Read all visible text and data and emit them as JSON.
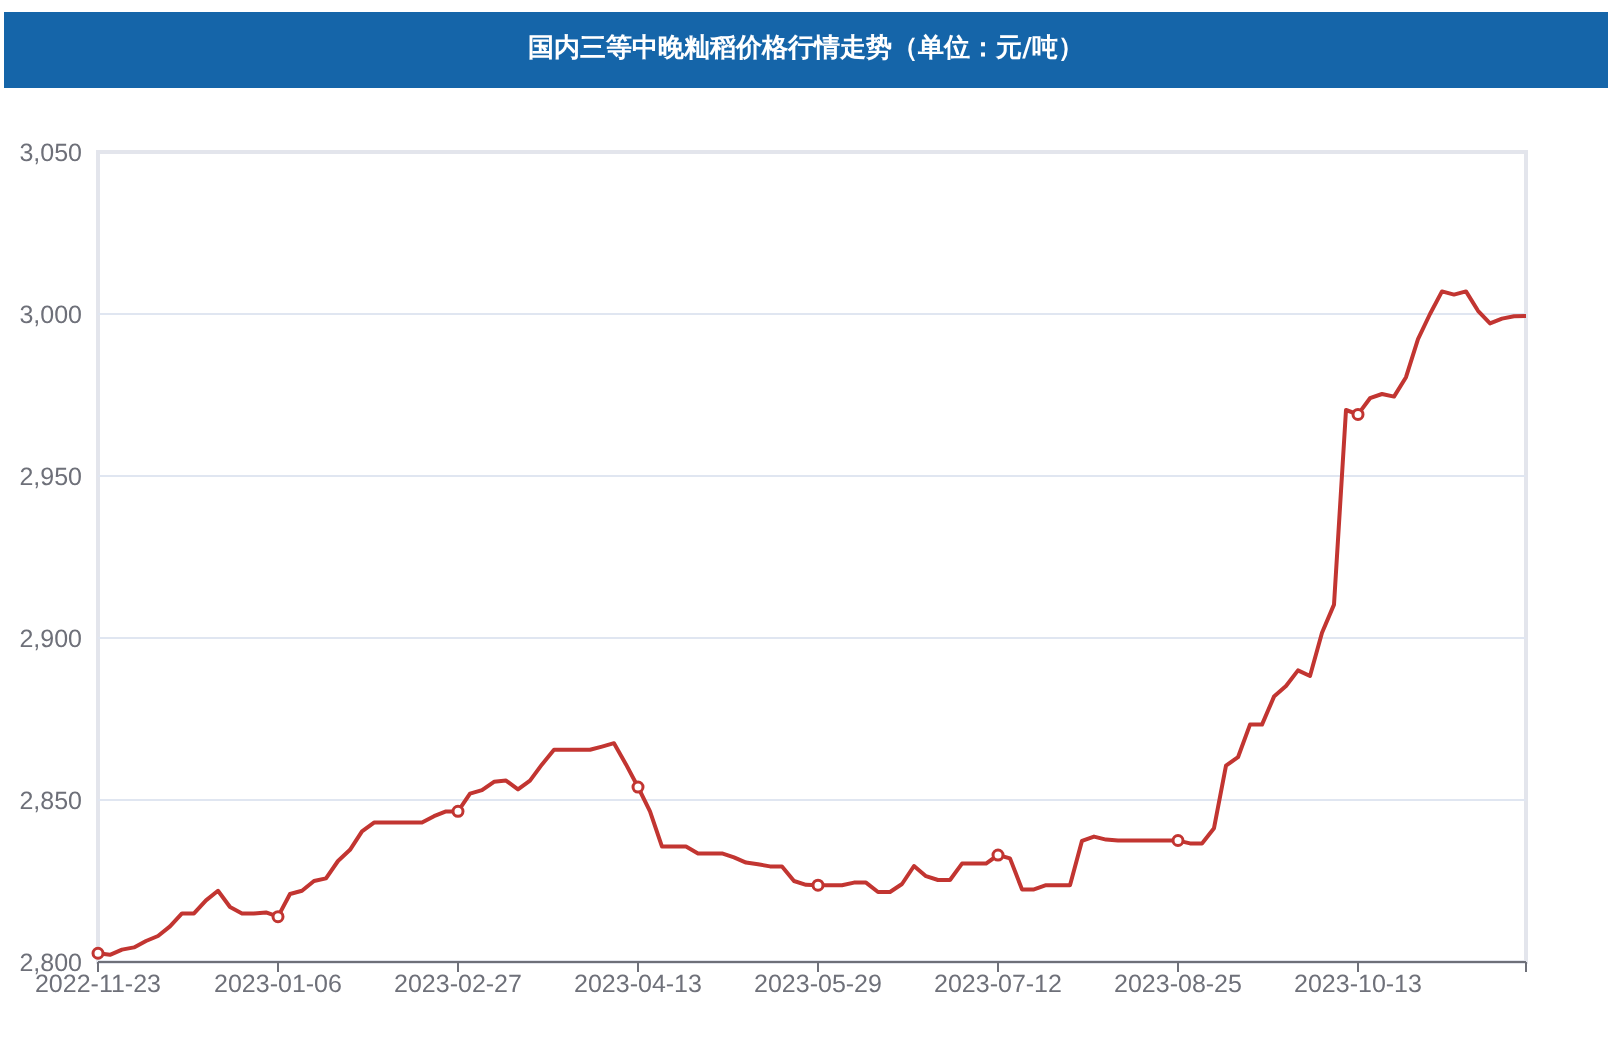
{
  "title_bar": {
    "text": "国内三等中晚籼稻价格行情走势（单位：元/吨）"
  },
  "chart": {
    "chart_data": {
      "type": "line",
      "categories": [
        "2022-11-23",
        null,
        null,
        null,
        null,
        null,
        null,
        null,
        null,
        null,
        null,
        null,
        null,
        null,
        null,
        "2023-01-06",
        null,
        null,
        null,
        null,
        null,
        null,
        null,
        null,
        null,
        null,
        null,
        null,
        null,
        null,
        "2023-02-27",
        null,
        null,
        null,
        null,
        null,
        null,
        null,
        null,
        null,
        null,
        null,
        null,
        null,
        null,
        "2023-04-13",
        null,
        null,
        null,
        null,
        null,
        null,
        null,
        null,
        null,
        null,
        null,
        null,
        null,
        null,
        "2023-05-29",
        null,
        null,
        null,
        null,
        null,
        null,
        null,
        null,
        null,
        null,
        null,
        null,
        null,
        null,
        "2023-07-12",
        null,
        null,
        null,
        null,
        null,
        null,
        null,
        null,
        null,
        null,
        null,
        null,
        null,
        null,
        "2023-08-25",
        null,
        null,
        null,
        null,
        null,
        null,
        null,
        null,
        null,
        null,
        null,
        null,
        null,
        null,
        "2023-10-13",
        null,
        null,
        null,
        null,
        null,
        null,
        null,
        null,
        null,
        null,
        null,
        null,
        null,
        null
      ],
      "series": [
        {
          "color": "#c23531",
          "values": [
            2802.7,
            2802.2,
            2803.8,
            2804.5,
            2806.5,
            2808,
            2811,
            2815,
            2815,
            2819,
            2822,
            2817,
            2815,
            2815,
            2815.3,
            2814,
            2821,
            2822,
            2825,
            2825.8,
            2831.2,
            2834.6,
            2840.3,
            2843,
            2843,
            2843,
            2843,
            2843,
            2845,
            2846.5,
            2846.5,
            2852,
            2853,
            2855.6,
            2856,
            2853.3,
            2856,
            2861,
            2865.5,
            2865.5,
            2865.5,
            2865.5,
            2866.5,
            2867.5,
            2861,
            2854,
            2846.5,
            2835.6,
            2835.6,
            2835.6,
            2833.5,
            2833.5,
            2833.5,
            2832.3,
            2830.7,
            2830.2,
            2829.5,
            2829.5,
            2825,
            2823.8,
            2823.7,
            2823.7,
            2823.7,
            2824.5,
            2824.5,
            2821.6,
            2821.6,
            2824.1,
            2829.6,
            2826.5,
            2825.3,
            2825.3,
            2830.4,
            2830.4,
            2830.4,
            2833,
            2832,
            2822.4,
            2822.4,
            2823.7,
            2823.7,
            2823.7,
            2837.4,
            2838.7,
            2837.8,
            2837.5,
            2837.5,
            2837.5,
            2837.5,
            2837.5,
            2837.5,
            2836.6,
            2836.6,
            2841.3,
            2860.6,
            2863.2,
            2873.3,
            2873.3,
            2881.9,
            2885.2,
            2890,
            2888.3,
            2901.6,
            2910.3,
            2970.4,
            2969,
            2974,
            2975.3,
            2974.5,
            2980.5,
            2992.2,
            3000,
            3007,
            3006,
            3007,
            3001,
            2997.1,
            2998.6,
            2999.3,
            2999.4
          ]
        }
      ],
      "ylim": [
        2800,
        3050
      ],
      "grid": true,
      "yticks": [
        {
          "value": 2800,
          "label": "2,800"
        },
        {
          "value": 2850,
          "label": "2,850"
        },
        {
          "value": 2900,
          "label": "2,900"
        },
        {
          "value": 2950,
          "label": "2,950"
        },
        {
          "value": 3000,
          "label": "3,000"
        },
        {
          "value": 3050,
          "label": "3,050"
        }
      ]
    }
  }
}
